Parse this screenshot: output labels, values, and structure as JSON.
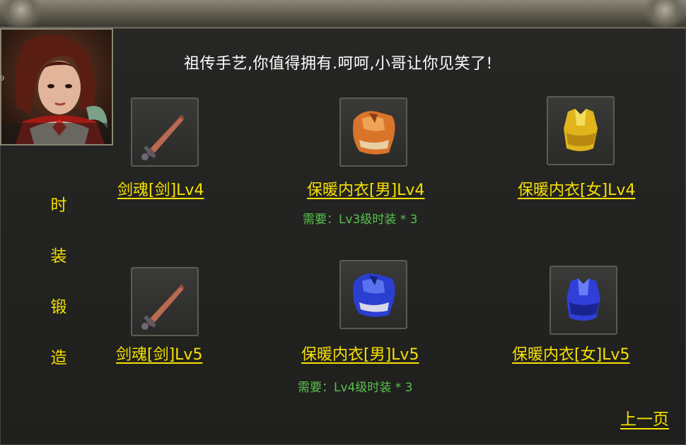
{
  "npc": {
    "dialog": "祖传手艺,你值得拥有.呵呵,小哥让你见笑了!",
    "side_digit": "9"
  },
  "category": {
    "chars": [
      "时",
      "装",
      "锻",
      "造"
    ]
  },
  "items": [
    {
      "name": "剑魂[剑]Lv4",
      "icon": "sword-icon",
      "requirement": ""
    },
    {
      "name": "保暖内衣[男]Lv4",
      "icon": "orange-robe-icon",
      "requirement": "需要：Lv3级时装 * 3"
    },
    {
      "name": "保暖内衣[女]Lv4",
      "icon": "gold-vest-icon",
      "requirement": ""
    },
    {
      "name": "剑魂[剑]Lv5",
      "icon": "sword-icon",
      "requirement": ""
    },
    {
      "name": "保暖内衣[男]Lv5",
      "icon": "blue-robe-icon",
      "requirement": "需要：Lv4级时装 * 3"
    },
    {
      "name": "保暖内衣[女]Lv5",
      "icon": "blue-vest-icon",
      "requirement": ""
    }
  ],
  "nav": {
    "prev_label": "上一页"
  },
  "colors": {
    "item_name": "#f7e100",
    "requirement": "#59c24e",
    "dialog": "#ffffff"
  }
}
